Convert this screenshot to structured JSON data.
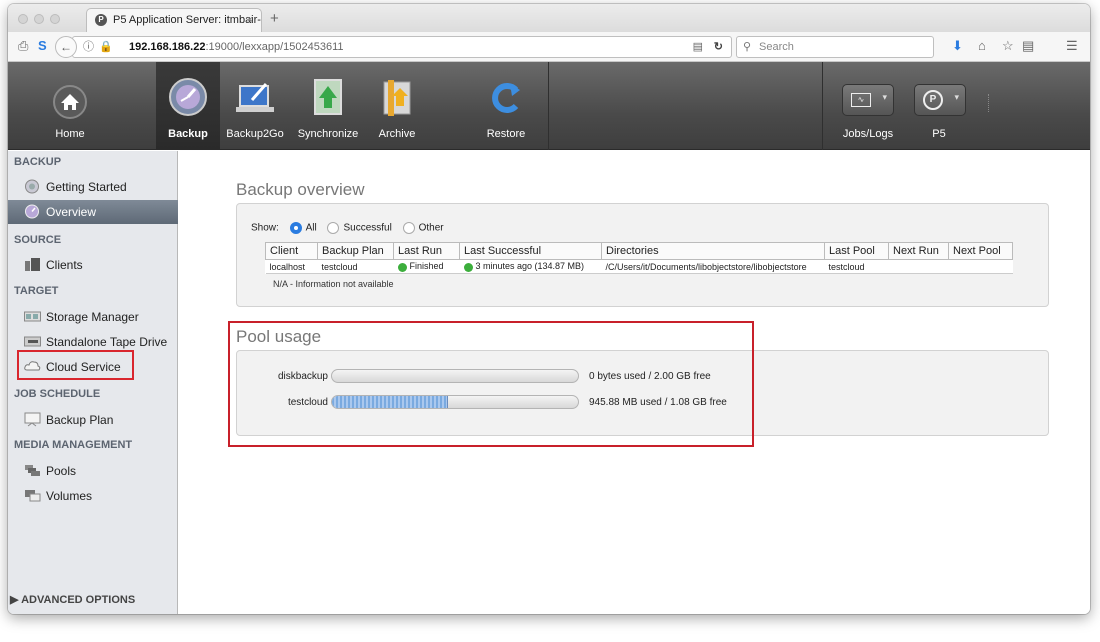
{
  "browser": {
    "tab_title": "P5 Application Server: itmbair-",
    "tab_close": "×",
    "new_tab": "+",
    "url_host": "192.168.186.22",
    "url_rest": ":19000/lexxapp/1502453611",
    "search_placeholder": "Search"
  },
  "toolbar": {
    "buttons": [
      {
        "label": "Home"
      },
      {
        "label": "Backup"
      },
      {
        "label": "Backup2Go"
      },
      {
        "label": "Synchronize"
      },
      {
        "label": "Archive"
      },
      {
        "label": "Restore"
      }
    ],
    "right": [
      {
        "label": "Jobs/Logs"
      },
      {
        "label": "P5"
      }
    ]
  },
  "sidebar": {
    "sections": {
      "backup": "BACKUP",
      "source": "SOURCE",
      "target": "TARGET",
      "job_schedule": "JOB SCHEDULE",
      "media": "MEDIA MANAGEMENT"
    },
    "items": {
      "getting_started": "Getting Started",
      "overview": "Overview",
      "clients": "Clients",
      "storage_manager": "Storage Manager",
      "tape_drive": "Standalone Tape Drive",
      "cloud_service": "Cloud Service",
      "backup_plan": "Backup Plan",
      "pools": "Pools",
      "volumes": "Volumes"
    },
    "advanced": "▶ ADVANCED OPTIONS"
  },
  "overview": {
    "title": "Backup overview",
    "show_label": "Show:",
    "filters": [
      "All",
      "Successful",
      "Other"
    ],
    "selected_filter": "All",
    "columns": [
      "Client",
      "Backup Plan",
      "Last Run",
      "Last Successful",
      "Directories",
      "Last Pool",
      "Next Run",
      "Next Pool"
    ],
    "rows": [
      {
        "client": "localhost",
        "plan": "testcloud",
        "last_run": "Finished",
        "last_successful": "3 minutes ago (134.87 MB)",
        "directories": "/C/Users/it/Documents/libobjectstore/libobjectstore",
        "last_pool": "testcloud",
        "next_run": "",
        "next_pool": ""
      }
    ],
    "note": "N/A - Information not available"
  },
  "pool_usage": {
    "title": "Pool usage",
    "pools": [
      {
        "name": "diskbackup",
        "fill": 0.0,
        "info": "0 bytes used / 2.00 GB free"
      },
      {
        "name": "testcloud",
        "fill": 0.47,
        "info": "945.88 MB used / 1.08 GB free"
      }
    ]
  }
}
